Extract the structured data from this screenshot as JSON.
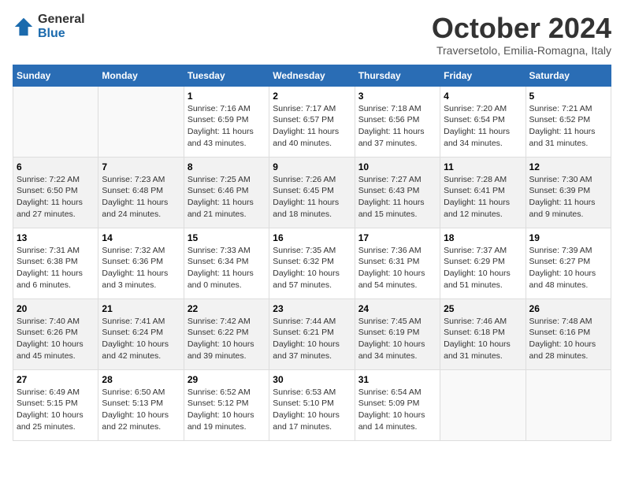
{
  "header": {
    "logo_general": "General",
    "logo_blue": "Blue",
    "month_title": "October 2024",
    "location": "Traversetolo, Emilia-Romagna, Italy"
  },
  "days_of_week": [
    "Sunday",
    "Monday",
    "Tuesday",
    "Wednesday",
    "Thursday",
    "Friday",
    "Saturday"
  ],
  "weeks": [
    [
      {
        "day": "",
        "info": ""
      },
      {
        "day": "",
        "info": ""
      },
      {
        "day": "1",
        "info": "Sunrise: 7:16 AM\nSunset: 6:59 PM\nDaylight: 11 hours and 43 minutes."
      },
      {
        "day": "2",
        "info": "Sunrise: 7:17 AM\nSunset: 6:57 PM\nDaylight: 11 hours and 40 minutes."
      },
      {
        "day": "3",
        "info": "Sunrise: 7:18 AM\nSunset: 6:56 PM\nDaylight: 11 hours and 37 minutes."
      },
      {
        "day": "4",
        "info": "Sunrise: 7:20 AM\nSunset: 6:54 PM\nDaylight: 11 hours and 34 minutes."
      },
      {
        "day": "5",
        "info": "Sunrise: 7:21 AM\nSunset: 6:52 PM\nDaylight: 11 hours and 31 minutes."
      }
    ],
    [
      {
        "day": "6",
        "info": "Sunrise: 7:22 AM\nSunset: 6:50 PM\nDaylight: 11 hours and 27 minutes."
      },
      {
        "day": "7",
        "info": "Sunrise: 7:23 AM\nSunset: 6:48 PM\nDaylight: 11 hours and 24 minutes."
      },
      {
        "day": "8",
        "info": "Sunrise: 7:25 AM\nSunset: 6:46 PM\nDaylight: 11 hours and 21 minutes."
      },
      {
        "day": "9",
        "info": "Sunrise: 7:26 AM\nSunset: 6:45 PM\nDaylight: 11 hours and 18 minutes."
      },
      {
        "day": "10",
        "info": "Sunrise: 7:27 AM\nSunset: 6:43 PM\nDaylight: 11 hours and 15 minutes."
      },
      {
        "day": "11",
        "info": "Sunrise: 7:28 AM\nSunset: 6:41 PM\nDaylight: 11 hours and 12 minutes."
      },
      {
        "day": "12",
        "info": "Sunrise: 7:30 AM\nSunset: 6:39 PM\nDaylight: 11 hours and 9 minutes."
      }
    ],
    [
      {
        "day": "13",
        "info": "Sunrise: 7:31 AM\nSunset: 6:38 PM\nDaylight: 11 hours and 6 minutes."
      },
      {
        "day": "14",
        "info": "Sunrise: 7:32 AM\nSunset: 6:36 PM\nDaylight: 11 hours and 3 minutes."
      },
      {
        "day": "15",
        "info": "Sunrise: 7:33 AM\nSunset: 6:34 PM\nDaylight: 11 hours and 0 minutes."
      },
      {
        "day": "16",
        "info": "Sunrise: 7:35 AM\nSunset: 6:32 PM\nDaylight: 10 hours and 57 minutes."
      },
      {
        "day": "17",
        "info": "Sunrise: 7:36 AM\nSunset: 6:31 PM\nDaylight: 10 hours and 54 minutes."
      },
      {
        "day": "18",
        "info": "Sunrise: 7:37 AM\nSunset: 6:29 PM\nDaylight: 10 hours and 51 minutes."
      },
      {
        "day": "19",
        "info": "Sunrise: 7:39 AM\nSunset: 6:27 PM\nDaylight: 10 hours and 48 minutes."
      }
    ],
    [
      {
        "day": "20",
        "info": "Sunrise: 7:40 AM\nSunset: 6:26 PM\nDaylight: 10 hours and 45 minutes."
      },
      {
        "day": "21",
        "info": "Sunrise: 7:41 AM\nSunset: 6:24 PM\nDaylight: 10 hours and 42 minutes."
      },
      {
        "day": "22",
        "info": "Sunrise: 7:42 AM\nSunset: 6:22 PM\nDaylight: 10 hours and 39 minutes."
      },
      {
        "day": "23",
        "info": "Sunrise: 7:44 AM\nSunset: 6:21 PM\nDaylight: 10 hours and 37 minutes."
      },
      {
        "day": "24",
        "info": "Sunrise: 7:45 AM\nSunset: 6:19 PM\nDaylight: 10 hours and 34 minutes."
      },
      {
        "day": "25",
        "info": "Sunrise: 7:46 AM\nSunset: 6:18 PM\nDaylight: 10 hours and 31 minutes."
      },
      {
        "day": "26",
        "info": "Sunrise: 7:48 AM\nSunset: 6:16 PM\nDaylight: 10 hours and 28 minutes."
      }
    ],
    [
      {
        "day": "27",
        "info": "Sunrise: 6:49 AM\nSunset: 5:15 PM\nDaylight: 10 hours and 25 minutes."
      },
      {
        "day": "28",
        "info": "Sunrise: 6:50 AM\nSunset: 5:13 PM\nDaylight: 10 hours and 22 minutes."
      },
      {
        "day": "29",
        "info": "Sunrise: 6:52 AM\nSunset: 5:12 PM\nDaylight: 10 hours and 19 minutes."
      },
      {
        "day": "30",
        "info": "Sunrise: 6:53 AM\nSunset: 5:10 PM\nDaylight: 10 hours and 17 minutes."
      },
      {
        "day": "31",
        "info": "Sunrise: 6:54 AM\nSunset: 5:09 PM\nDaylight: 10 hours and 14 minutes."
      },
      {
        "day": "",
        "info": ""
      },
      {
        "day": "",
        "info": ""
      }
    ]
  ]
}
